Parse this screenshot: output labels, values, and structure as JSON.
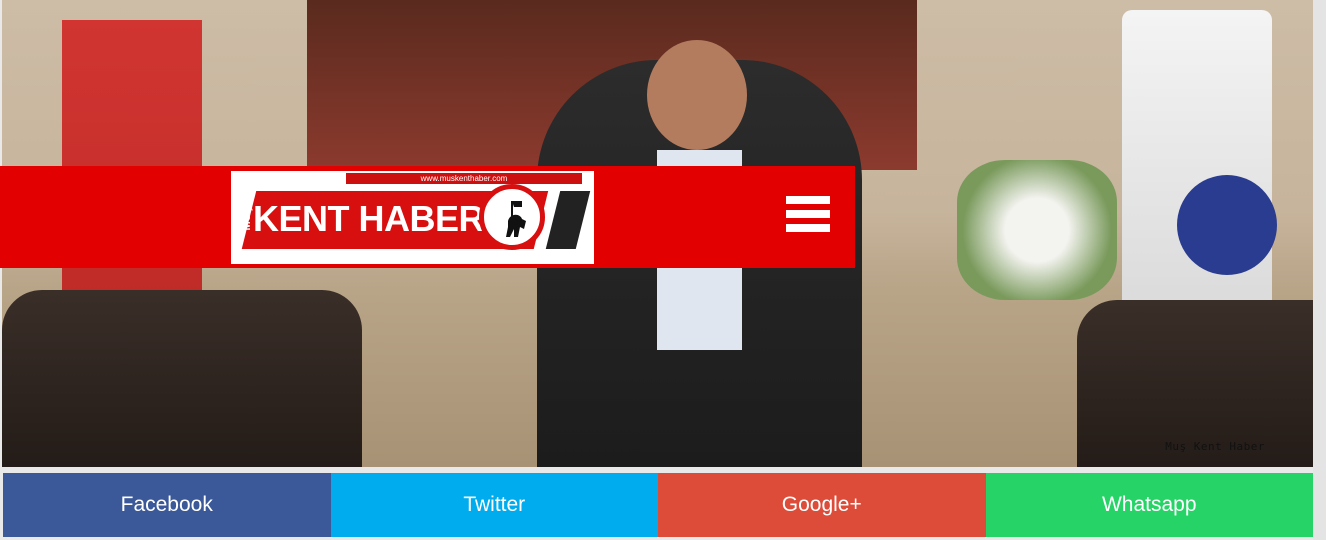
{
  "header": {
    "logo": {
      "url_text": "www.muskenthaber.com",
      "mus_text": "MUŞ",
      "brand_text": "KENT HABER"
    },
    "menu_icon": "hamburger-menu-icon"
  },
  "photo": {
    "watermark": "Muş Kent Haber"
  },
  "share": {
    "buttons": [
      {
        "label": "Facebook",
        "color": "#3b5998"
      },
      {
        "label": "Twitter",
        "color": "#00aced"
      },
      {
        "label": "Google+",
        "color": "#dd4b39"
      },
      {
        "label": "Whatsapp",
        "color": "#25d366"
      }
    ]
  },
  "colors": {
    "header_red": "#e20000"
  }
}
